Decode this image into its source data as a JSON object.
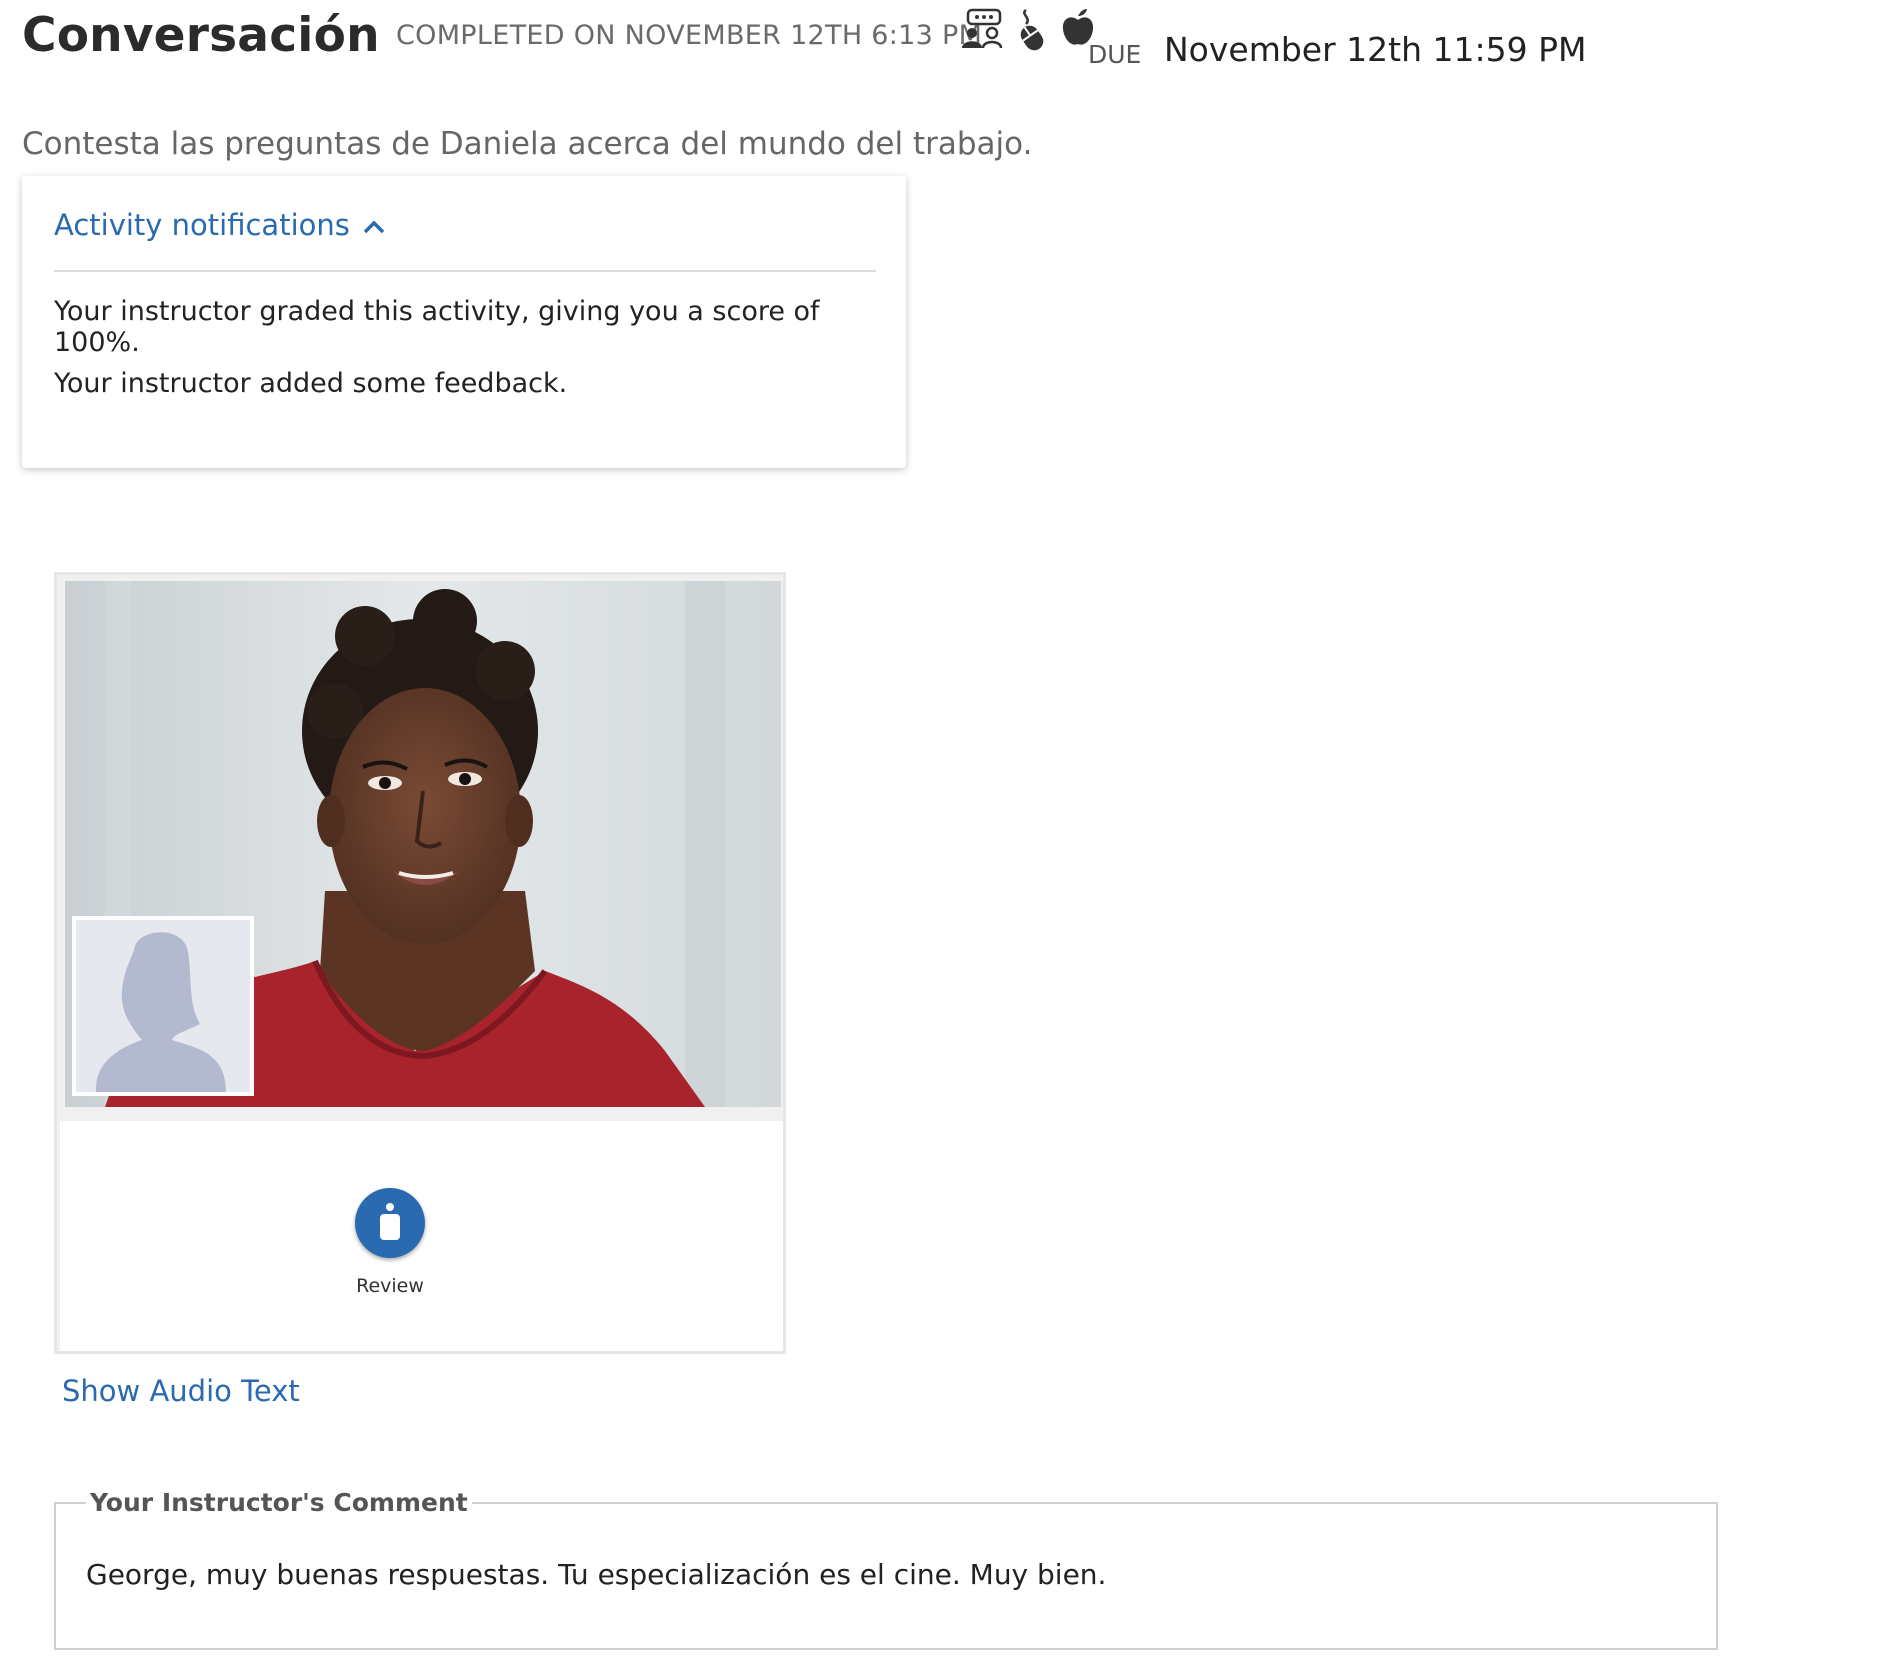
{
  "header": {
    "title": "Conversación",
    "completed_text": "COMPLETED ON NOVEMBER 12TH 6:13 PM",
    "icons": [
      "conversation-group-icon",
      "mouse-click-icon",
      "apple-icon"
    ],
    "due_label": "DUE",
    "due_date": "November 12th 11:59 PM"
  },
  "instructions": "Contesta las preguntas de Daniela acerca del mundo del trabajo.",
  "notifications": {
    "toggle_label": "Activity notifications",
    "toggle_icon": "chevron-up-icon",
    "items": [
      "Your instructor graded this activity, giving you a score of 100%.",
      "Your instructor added some feedback."
    ]
  },
  "activity": {
    "main_image_icon": "speaker-photo",
    "thumbnail_icon": "user-silhouette-icon",
    "review_icon": "microphone-icon",
    "review_label": "Review",
    "audio_link": "Show Audio Text"
  },
  "comment": {
    "legend": "Your Instructor's Comment",
    "text": "George, muy buenas respuestas. Tu especialización es el cine. Muy bien."
  },
  "colors": {
    "accent_blue": "#2a6ab0",
    "shirt_red": "#a8232b"
  }
}
